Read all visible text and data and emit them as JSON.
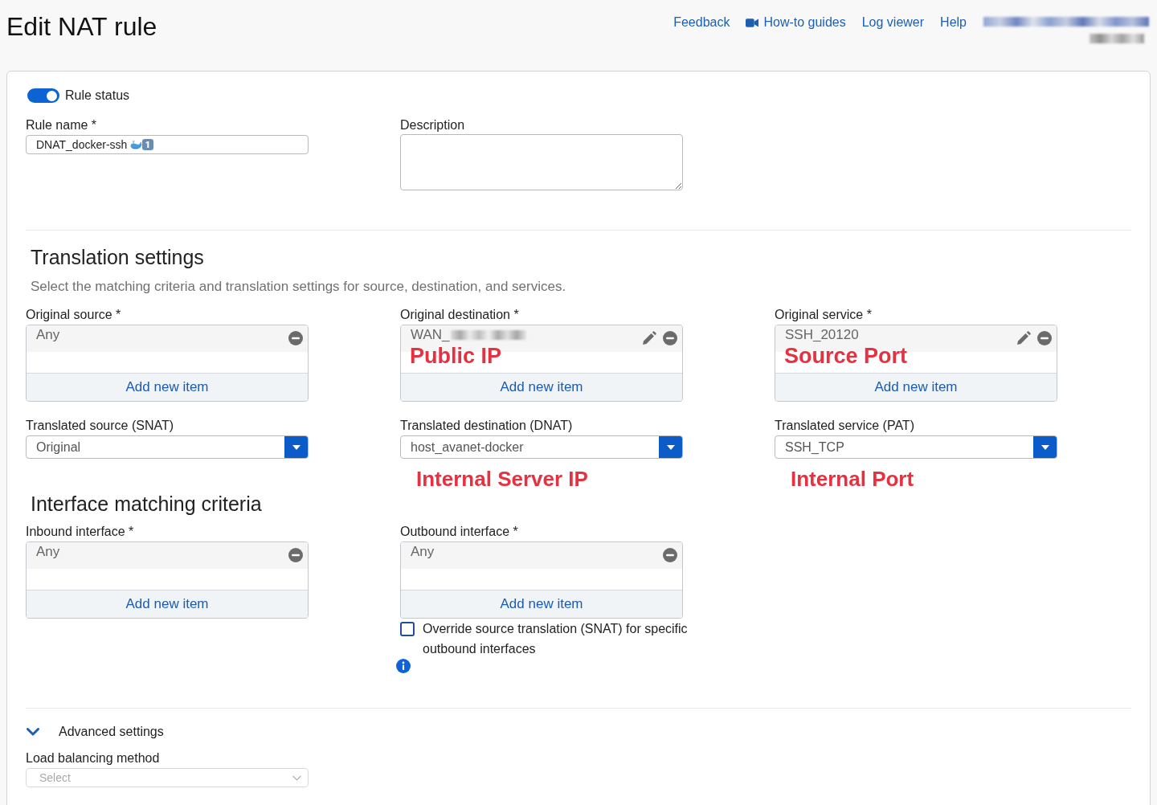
{
  "header": {
    "title": "Edit NAT rule",
    "links": [
      {
        "label": "Feedback",
        "kind": "text"
      },
      {
        "label": "How-to guides",
        "kind": "video"
      },
      {
        "label": "Log viewer",
        "kind": "text"
      },
      {
        "label": "Help",
        "kind": "text"
      }
    ],
    "account_blurred": true
  },
  "rule_status": {
    "label": "Rule status",
    "on": true
  },
  "rule_name": {
    "label": "Rule name *",
    "value": "DNAT_docker-ssh"
  },
  "description": {
    "label": "Description"
  },
  "translation_settings": {
    "title": "Translation settings",
    "subtitle": "Select the matching criteria and translation settings for source, destination, and services.",
    "fields": [
      {
        "kind": "list",
        "label": "Original source *",
        "items": [
          {
            "text": "Any",
            "editable": false,
            "blurred": false
          }
        ],
        "add_label": "Add new item"
      },
      {
        "kind": "list",
        "label": "Original destination *",
        "items": [
          {
            "text": "WAN_",
            "editable": true,
            "blurred": true
          }
        ],
        "annotation": "Public IP",
        "add_label": "Add new item"
      },
      {
        "kind": "list",
        "label": "Original service *",
        "items": [
          {
            "text": "SSH_20120",
            "editable": true,
            "blurred": false
          }
        ],
        "annotation": "Source Port",
        "add_label": "Add new item"
      },
      {
        "kind": "select",
        "label": "Translated source (SNAT)",
        "value": "Original",
        "disabled": false
      },
      {
        "kind": "select",
        "label": "Translated destination (DNAT)",
        "value": "host_avanet-docker",
        "disabled": false,
        "annotation": "Internal Server IP"
      },
      {
        "kind": "select",
        "label": "Translated service (PAT)",
        "value": "SSH_TCP",
        "disabled": false,
        "annotation": "Internal Port"
      }
    ]
  },
  "interface_matching": {
    "title": "Interface matching criteria",
    "fields": [
      {
        "kind": "list",
        "label": "Inbound interface *",
        "items": [
          {
            "text": "Any",
            "editable": false,
            "blurred": false
          }
        ],
        "add_label": "Add new item"
      },
      {
        "kind": "list",
        "label": "Outbound interface *",
        "items": [
          {
            "text": "Any",
            "editable": false,
            "blurred": false
          }
        ],
        "add_label": "Add new item",
        "option": {
          "label": "Override source translation (SNAT) for specific outbound interfaces",
          "checked": false
        }
      }
    ]
  },
  "advanced_settings": {
    "label": "Advanced settings",
    "expanded": true,
    "fields": [
      {
        "kind": "select",
        "label": "Load balancing method",
        "placeholder": "Select",
        "disabled": true
      }
    ]
  }
}
